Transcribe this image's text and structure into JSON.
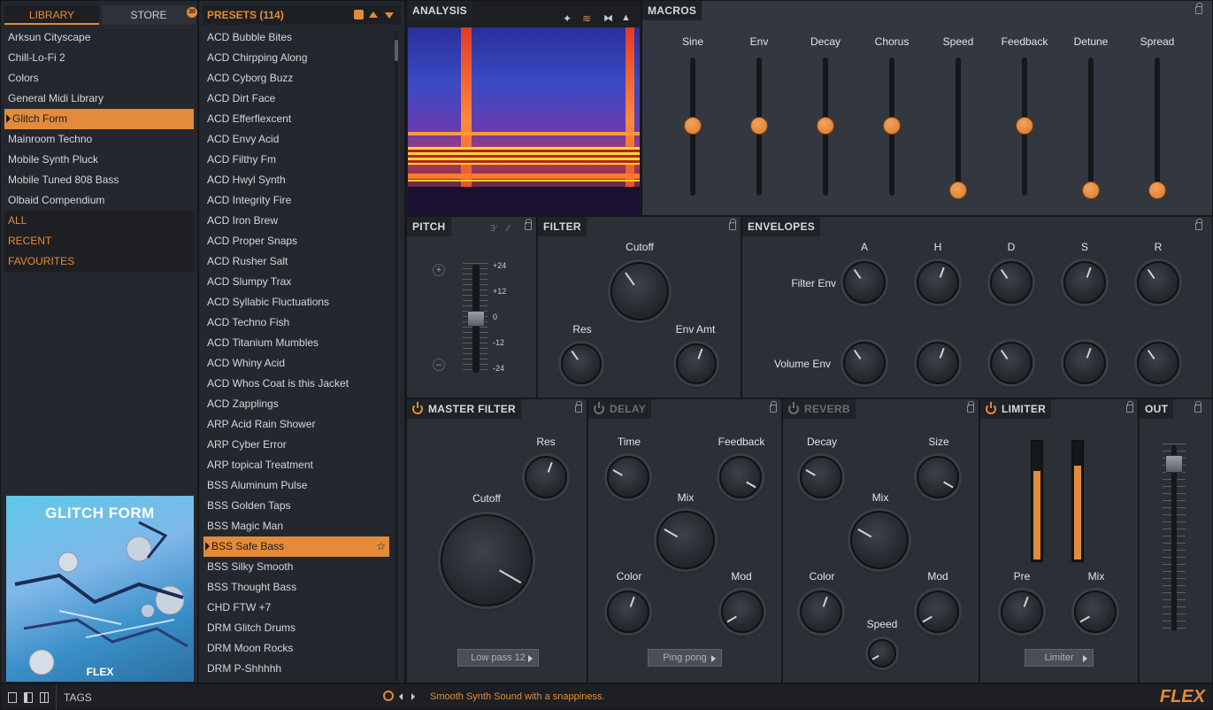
{
  "library": {
    "tab_library": "LIBRARY",
    "tab_store": "STORE",
    "store_badge": "30",
    "items": [
      "Arksun Cityscape",
      "Chill-Lo-Fi 2",
      "Colors",
      "General Midi Library",
      "Glitch Form",
      "Mainroom Techno",
      "Mobile Synth Pluck",
      "Mobile Tuned 808 Bass",
      "Olbaid Compendium"
    ],
    "selected_index": 4,
    "filters": [
      "ALL",
      "RECENT",
      "FAVOURITES"
    ],
    "cover_title": "GLITCH FORM",
    "cover_brand": "FLEX"
  },
  "presets": {
    "header": "PRESETS (114)",
    "items": [
      "ACD Bubble Bites",
      "ACD Chirpping Along",
      "ACD Cyborg Buzz",
      "ACD Dirt Face",
      "ACD Efferflexcent",
      "ACD Envy Acid",
      "ACD Filthy Fm",
      "ACD Hwyl Synth",
      "ACD Integrity Fire",
      "ACD Iron Brew",
      "ACD Proper Snaps",
      "ACD Rusher Salt",
      "ACD Slumpy Trax",
      "ACD Syllabic Fluctuations",
      "ACD Techno Fish",
      "ACD Titanium Mumbles",
      "ACD Whiny Acid",
      "ACD Whos Coat is this Jacket",
      "ACD Zapplings",
      "ARP Acid Rain Shower",
      "ARP Cyber Error",
      "ARP topical Treatment",
      "BSS Aluminum Pulse",
      "BSS Golden Taps",
      "BSS Magic Man",
      "BSS Safe Bass",
      "BSS Silky Smooth",
      "BSS Thought Bass",
      "CHD FTW +7",
      "DRM Glitch Drums",
      "DRM Moon Rocks",
      "DRM P-Shhhhh"
    ],
    "selected_index": 25
  },
  "analysis": {
    "title": "ANALYSIS"
  },
  "macros": {
    "title": "MACROS",
    "items": [
      {
        "label": "Sine",
        "value": 0.5
      },
      {
        "label": "Env",
        "value": 0.5
      },
      {
        "label": "Decay",
        "value": 0.5
      },
      {
        "label": "Chorus",
        "value": 0.5
      },
      {
        "label": "Speed",
        "value": 0.0
      },
      {
        "label": "Feedback",
        "value": 0.5
      },
      {
        "label": "Detune",
        "value": 0.0
      },
      {
        "label": "Spread",
        "value": 0.0
      }
    ]
  },
  "pitch": {
    "title": "PITCH",
    "scale": [
      "+24",
      "+12",
      "0",
      "-12",
      "-24"
    ],
    "plus": "+",
    "minus": "–"
  },
  "filter": {
    "title": "FILTER",
    "cutoff": "Cutoff",
    "res": "Res",
    "env_amt": "Env Amt"
  },
  "envelopes": {
    "title": "ENVELOPES",
    "cols": [
      "A",
      "H",
      "D",
      "S",
      "R"
    ],
    "row1": "Filter Env",
    "row2": "Volume Env"
  },
  "master_filter": {
    "title": "MASTER FILTER",
    "res": "Res",
    "cutoff": "Cutoff",
    "mode": "Low pass 12"
  },
  "delay": {
    "title": "DELAY",
    "time": "Time",
    "feedback": "Feedback",
    "mix": "Mix",
    "color": "Color",
    "mod": "Mod",
    "mode": "Ping pong"
  },
  "reverb": {
    "title": "REVERB",
    "decay": "Decay",
    "size": "Size",
    "mix": "Mix",
    "color": "Color",
    "mod": "Mod",
    "speed": "Speed"
  },
  "limiter": {
    "title": "LIMITER",
    "pre": "Pre",
    "mix": "Mix",
    "mode": "Limiter",
    "meter_left": 0.76,
    "meter_right": 0.8
  },
  "out": {
    "title": "OUT",
    "level": 0.92
  },
  "bottom": {
    "tags": "TAGS",
    "status": "Smooth Synth Sound with a snappiness.",
    "brand": "FLEX"
  }
}
